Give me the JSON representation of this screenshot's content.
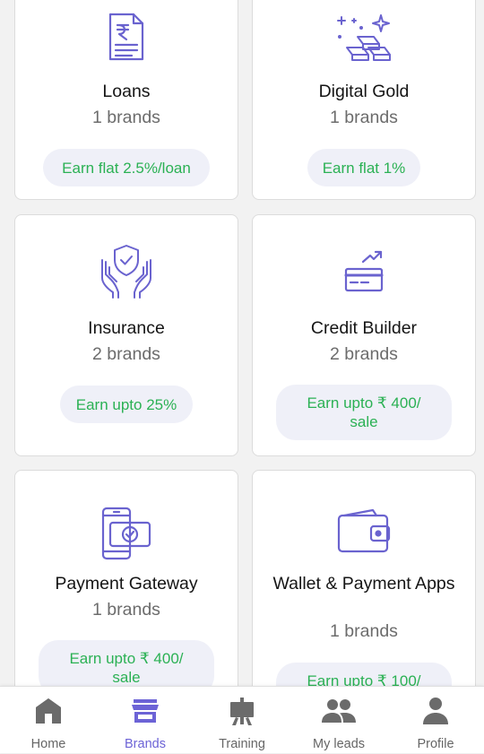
{
  "colors": {
    "accent": "#6c63d6",
    "icon_stroke": "#6a63cf",
    "earn_text": "#2bb154",
    "pill_bg": "#eff0f8",
    "nav_inactive": "#666666"
  },
  "cards": [
    {
      "title": "Loans",
      "brands": "1 brands",
      "earn": "Earn flat 2.5%/loan",
      "icon": "loan-document-rupee-icon"
    },
    {
      "title": "Digital Gold",
      "brands": "1 brands",
      "earn": "Earn flat 1%",
      "icon": "gold-bars-icon"
    },
    {
      "title": "Insurance",
      "brands": "2 brands",
      "earn": "Earn upto 25%",
      "icon": "shield-hands-icon"
    },
    {
      "title": "Credit Builder",
      "brands": "2 brands",
      "earn": "Earn upto ₹ 400/ sale",
      "icon": "credit-card-trend-icon"
    },
    {
      "title": "Payment Gateway",
      "brands": "1 brands",
      "earn": "Earn upto ₹ 400/ sale",
      "icon": "phone-payment-icon"
    },
    {
      "title": "Wallet & Payment Apps",
      "brands": "1 brands",
      "earn": "Earn upto ₹ 100/",
      "icon": "wallet-icon"
    }
  ],
  "nav": {
    "active": "Brands",
    "items": [
      {
        "label": "Home",
        "icon": "home-icon"
      },
      {
        "label": "Brands",
        "icon": "store-icon"
      },
      {
        "label": "Training",
        "icon": "presentation-board-icon"
      },
      {
        "label": "My leads",
        "icon": "people-icon"
      },
      {
        "label": "Profile",
        "icon": "person-icon"
      }
    ]
  }
}
